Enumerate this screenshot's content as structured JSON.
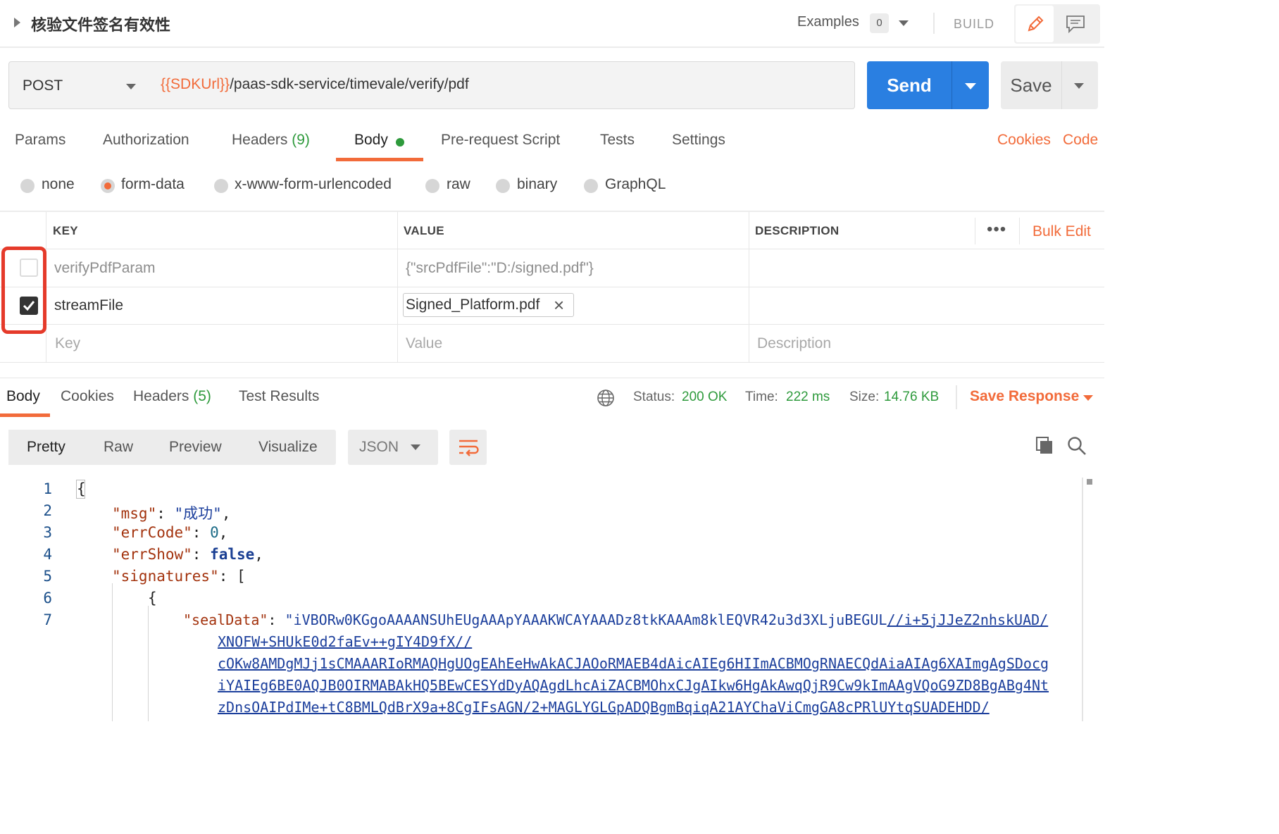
{
  "title_bar": {
    "request_name": "核验文件签名有效性",
    "examples_label": "Examples",
    "examples_count": "0",
    "build_label": "BUILD"
  },
  "request": {
    "method": "POST",
    "url_variable": "{{SDKUrl}}",
    "url_path": "/paas-sdk-service/timevale/verify/pdf",
    "send_label": "Send",
    "save_label": "Save"
  },
  "request_tabs": {
    "params": "Params",
    "authorization": "Authorization",
    "headers": "Headers",
    "headers_count": "(9)",
    "body": "Body",
    "prerequest": "Pre-request Script",
    "tests": "Tests",
    "settings": "Settings",
    "cookies_link": "Cookies",
    "code_link": "Code"
  },
  "body_types": {
    "none": "none",
    "form_data": "form-data",
    "urlencoded": "x-www-form-urlencoded",
    "raw": "raw",
    "binary": "binary",
    "graphql": "GraphQL",
    "selected": "form-data"
  },
  "params_table": {
    "headers": {
      "key": "KEY",
      "value": "VALUE",
      "description": "DESCRIPTION"
    },
    "more_label": "•••",
    "bulk_edit": "Bulk Edit",
    "rows": [
      {
        "checked": false,
        "key": "verifyPdfParam",
        "value": "{\"srcPdfFile\":\"D:/signed.pdf\"}",
        "description": ""
      },
      {
        "checked": true,
        "key": "streamFile",
        "value_file": "Signed_Platform.pdf",
        "description": ""
      }
    ],
    "placeholder": {
      "key": "Key",
      "value": "Value",
      "description": "Description"
    }
  },
  "response_tabs": {
    "body": "Body",
    "cookies": "Cookies",
    "headers": "Headers",
    "headers_count": "(5)",
    "test_results": "Test Results"
  },
  "response_status": {
    "status_label": "Status:",
    "status_value": "200 OK",
    "time_label": "Time:",
    "time_value": "222 ms",
    "size_label": "Size:",
    "size_value": "14.76 KB",
    "save_response": "Save Response"
  },
  "response_toolbar": {
    "pretty": "Pretty",
    "raw": "Raw",
    "preview": "Preview",
    "visualize": "Visualize",
    "format": "JSON"
  },
  "code": {
    "line_numbers": [
      "1",
      "2",
      "3",
      "4",
      "5",
      "6",
      "7"
    ],
    "open_brace": "{",
    "msg_key": "\"msg\"",
    "msg_value": "\"成功\"",
    "errcode_key": "\"errCode\"",
    "errcode_value": "0",
    "errshow_key": "\"errShow\"",
    "errshow_value": "false",
    "signatures_key": "\"signatures\"",
    "inner_open": "{",
    "sealdata_key": "\"sealData\"",
    "sealdata_head": "\"iVBORw0KGgoAAAANSUhEUgAAApYAAAKWCAYAAADz8tkKAAAm8klEQVR42u3d3XLjuBEGUL",
    "sealdata_link1": "//i+5jJJeZ2nhskUAD/",
    "sealdata_link2": "XNOFW+SHUkE0d2faEv++gIY4D9fX//",
    "sealdata_link3": "cOKw8AMDgMJj1sCMAAARIoRMAQHgUOgEAhEeHwAkACJAOoRMAEB4dAicAIEg6HIImACBMOgRNAECQdAiaAIAg6XAImgAgSDocg",
    "sealdata_link4": "iYAIEg6BE0AQJB0OIRMABAkHQ5BEwCESYdDyAQAgdLhcAiZACBMOhxCJgAIkw6HgAkAwqQjR9Cw9kImAAgVQoG9ZD8BgABg4Nt",
    "sealdata_link5": "zDnsOAIPdIMe+tC8BMLQdBrX9a+8CgIFsAGN/2+MAGLYGLGpADQBgmBqiqA21AYChaViCmgGA8cPRlUYtqSUADEHDD/"
  }
}
